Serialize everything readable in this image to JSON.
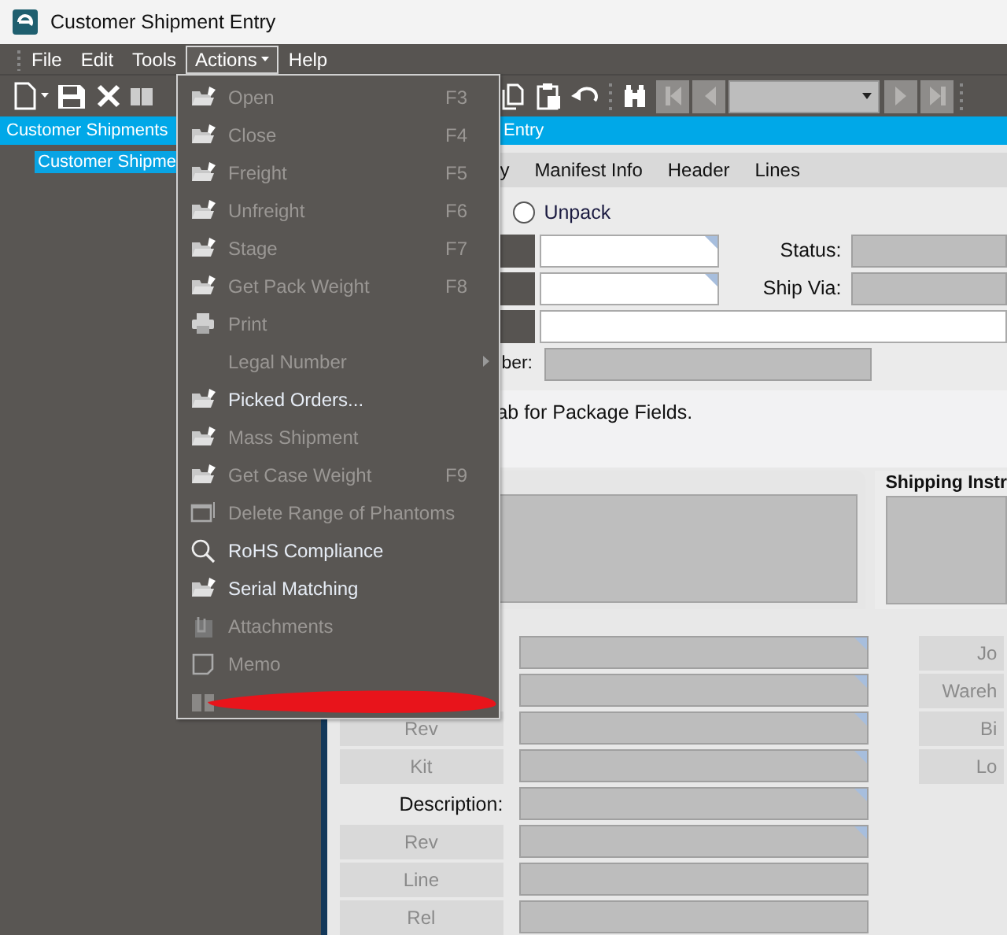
{
  "window": {
    "title": "Customer Shipment Entry"
  },
  "menubar": [
    {
      "label": "File",
      "selected": false
    },
    {
      "label": "Edit",
      "selected": false
    },
    {
      "label": "Tools",
      "selected": false
    },
    {
      "label": "Actions",
      "selected": true,
      "dropdown": true
    },
    {
      "label": "Help",
      "selected": false
    }
  ],
  "header_bar": {
    "left": "Customer Shipments",
    "right": "Entry"
  },
  "tree": [
    {
      "label": "Customer Shipme",
      "selected": true
    }
  ],
  "tabs": [
    "y",
    "Manifest Info",
    "Header",
    "Lines"
  ],
  "form": {
    "unpack": {
      "label": "Unpack",
      "selected": false
    },
    "rows": [
      {
        "kind": "pair",
        "label": "Status:"
      },
      {
        "kind": "pair",
        "label": "Ship Via:"
      },
      {
        "kind": "wide"
      },
      {
        "kind": "short",
        "label": "ber:"
      }
    ],
    "message": "ab for Package Fields."
  },
  "panels": {
    "right_title": "Shipping Instr"
  },
  "lines": {
    "left": [
      {
        "kind": "blank"
      },
      {
        "kind": "blank"
      },
      {
        "kind": "button",
        "label": "Rev"
      },
      {
        "kind": "button",
        "label": "Kit"
      },
      {
        "kind": "label",
        "label": "Description:"
      },
      {
        "kind": "button",
        "label": "Rev"
      },
      {
        "kind": "button",
        "label": "Line"
      },
      {
        "kind": "button",
        "label": "Rel"
      }
    ],
    "fields": [
      {
        "corner_mark": true
      },
      {
        "corner_mark": true
      },
      {
        "corner_mark": true
      },
      {
        "corner_mark": true
      },
      {
        "corner_mark": true
      },
      {
        "corner_mark": true
      },
      {
        "corner_mark": false
      },
      {
        "corner_mark": false
      }
    ],
    "right": [
      "Jo",
      "Wareh",
      "Bi",
      "Lo"
    ]
  },
  "actions_menu": [
    {
      "kind": "folder",
      "label": "Open",
      "shortcut": "F3",
      "disabled": true
    },
    {
      "kind": "folder",
      "label": "Close",
      "shortcut": "F4",
      "disabled": true
    },
    {
      "kind": "folder",
      "label": "Freight",
      "shortcut": "F5",
      "disabled": true
    },
    {
      "kind": "folder",
      "label": "Unfreight",
      "shortcut": "F6",
      "disabled": true
    },
    {
      "kind": "folder",
      "label": "Stage",
      "shortcut": "F7",
      "disabled": true
    },
    {
      "kind": "folder",
      "label": "Get Pack Weight",
      "shortcut": "F8",
      "disabled": true
    },
    {
      "kind": "printer",
      "label": "Print",
      "disabled": true
    },
    {
      "kind": "plain",
      "label": "Legal Number",
      "disabled": true,
      "submenu": true
    },
    {
      "kind": "folder",
      "label": "Picked Orders...",
      "disabled": false
    },
    {
      "kind": "folder",
      "label": "Mass Shipment",
      "disabled": true
    },
    {
      "kind": "folder",
      "label": "Get Case Weight",
      "shortcut": "F9",
      "disabled": true
    },
    {
      "kind": "window",
      "label": "Delete Range of Phantoms",
      "disabled": true
    },
    {
      "kind": "magnifier",
      "label": "RoHS Compliance",
      "disabled": false
    },
    {
      "kind": "folder",
      "label": "Serial Matching",
      "disabled": false
    },
    {
      "kind": "attachment",
      "label": "Attachments",
      "disabled": true
    },
    {
      "kind": "memo",
      "label": "Memo",
      "disabled": true
    },
    {
      "kind": "book",
      "disabled": true,
      "redacted": true
    }
  ]
}
